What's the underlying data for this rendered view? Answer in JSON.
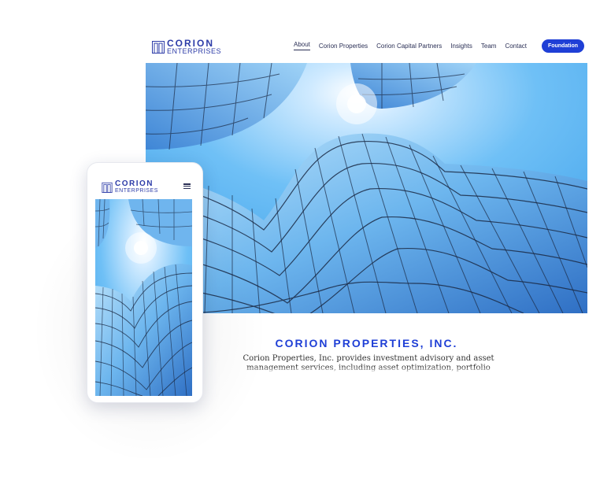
{
  "brand": {
    "line1": "CORION",
    "line2": "ENTERPRISES",
    "color": "#2d3ca8"
  },
  "nav": [
    {
      "label": "About",
      "active": true
    },
    {
      "label": "Corion Properties",
      "active": false
    },
    {
      "label": "Corion Capital Partners",
      "active": false
    },
    {
      "label": "Insights",
      "active": false
    },
    {
      "label": "Team",
      "active": false
    },
    {
      "label": "Contact",
      "active": false
    }
  ],
  "cta": {
    "label": "Foundation",
    "color": "#1f3fd6"
  },
  "hero": {
    "image": "skyscraper-looking-up",
    "sky": "#48a8ef"
  },
  "content": {
    "title": "CORION PROPERTIES, INC.",
    "description": "Corion Properties, Inc. provides investment advisory and asset management services, including asset optimization, portfolio strategy"
  },
  "mobile": {
    "menu_icon": "hamburger-icon"
  }
}
